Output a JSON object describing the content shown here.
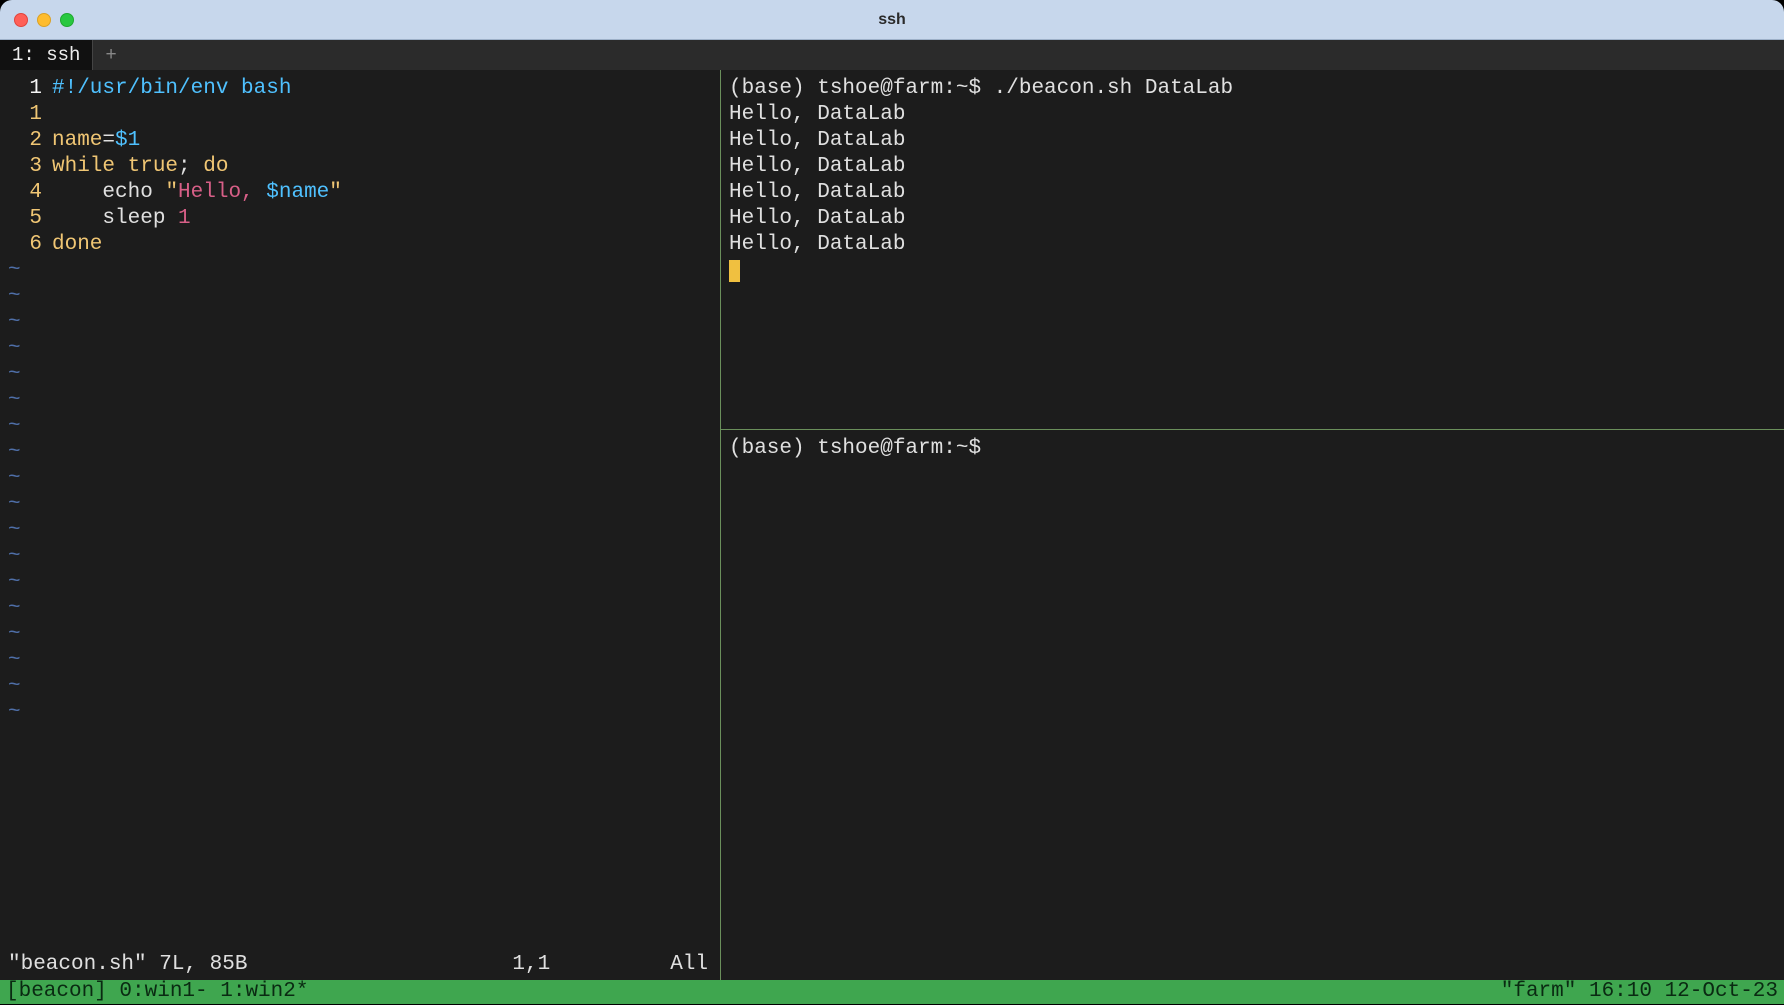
{
  "window": {
    "title": "ssh"
  },
  "tabstrip": {
    "tab_label": "1: ssh",
    "add_label": "+"
  },
  "vim": {
    "current_line_marker": "1",
    "lines": [
      {
        "ln": "1",
        "tokens": [
          [
            "shebang",
            "#!/usr/bin/env bash"
          ]
        ]
      },
      {
        "ln": "2",
        "tokens": [
          [
            "var",
            "name"
          ],
          [
            "op",
            "="
          ],
          [
            "num",
            "$1"
          ]
        ]
      },
      {
        "ln": "3",
        "tokens": [
          [
            "key",
            "while "
          ],
          [
            "key",
            "true"
          ],
          [
            "plain",
            "; "
          ],
          [
            "key",
            "do"
          ]
        ]
      },
      {
        "ln": "4",
        "tokens": [
          [
            "plain",
            "    "
          ],
          [
            "cmd",
            "echo "
          ],
          [
            "str",
            "\""
          ],
          [
            "strin",
            "Hello, "
          ],
          [
            "strvar",
            "$name"
          ],
          [
            "str",
            "\""
          ]
        ]
      },
      {
        "ln": "5",
        "tokens": [
          [
            "plain",
            "    "
          ],
          [
            "cmd",
            "sleep "
          ],
          [
            "strin",
            "1"
          ]
        ]
      },
      {
        "ln": "6",
        "tokens": [
          [
            "key",
            "done"
          ]
        ]
      }
    ],
    "tilde_count": 18,
    "status_left": "\"beacon.sh\" 7L, 85B",
    "status_mid": "1,1",
    "status_right": "All"
  },
  "shell_top": {
    "prompt": "(base) tshoe@farm:~$ ./beacon.sh DataLab",
    "output_line": "Hello, DataLab",
    "output_repeat": 6
  },
  "shell_bottom": {
    "prompt": "(base) tshoe@farm:~$ "
  },
  "tmux": {
    "left": "[beacon] 0:win1- 1:win2*",
    "right": "\"farm\" 16:10 12-Oct-23"
  }
}
